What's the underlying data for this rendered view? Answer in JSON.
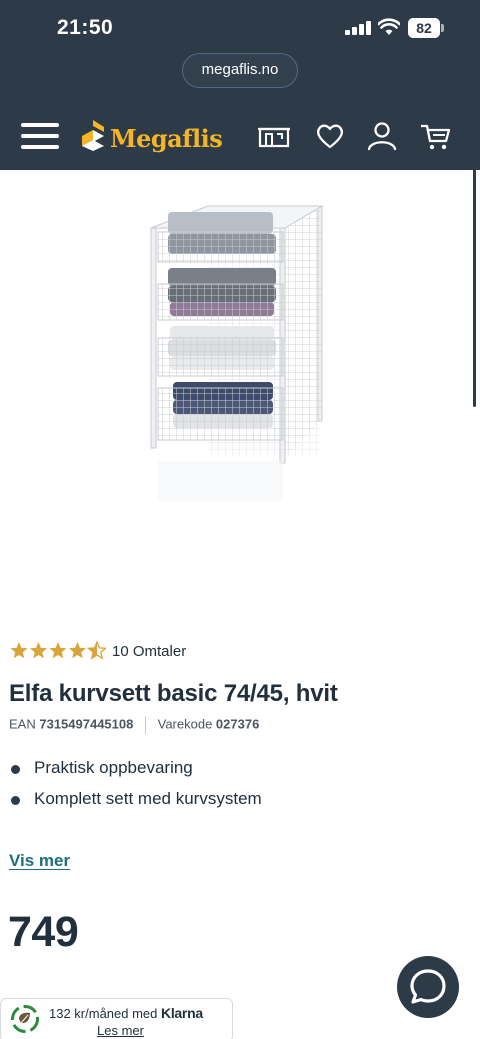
{
  "status_bar": {
    "time": "21:50",
    "battery": "82"
  },
  "browser": {
    "url": "megaflis.no"
  },
  "header": {
    "logo_text": "Megaflis",
    "icons": [
      "menu-icon",
      "store-icon",
      "heart-icon",
      "user-icon",
      "cart-icon"
    ],
    "colors": {
      "background": "#2d3a48",
      "logo": "#f5b526"
    }
  },
  "product": {
    "rating": 4.5,
    "review_label": "10 Omtaler",
    "title": "Elfa kurvsett basic 74/45, hvit",
    "ean_label": "EAN",
    "ean": "7315497445108",
    "sku_label": "Varekode",
    "sku": "027376",
    "features": [
      "Praktisk oppbevaring",
      "Komplett sett med kurvsystem"
    ],
    "read_more": "Vis mer",
    "price": "749"
  },
  "klarna": {
    "text": "132 kr/måned med",
    "brand": "Klarna",
    "link": "Les mer"
  },
  "colors": {
    "star": "#d9a53a",
    "link": "#1f6e7a"
  }
}
